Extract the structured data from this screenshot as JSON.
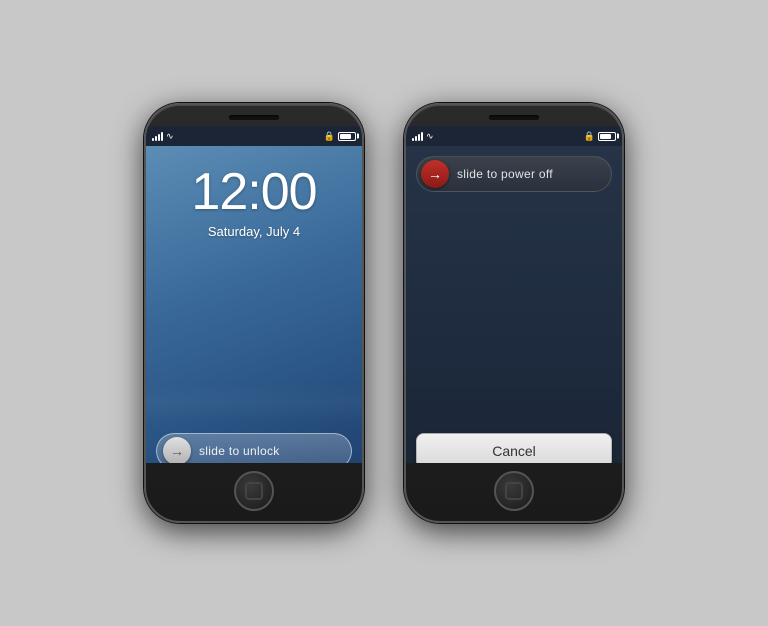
{
  "phone1": {
    "signal": "●●●●",
    "wifi": "wifi",
    "battery": "battery",
    "lock_symbol": "🔒",
    "time": "12:00",
    "date": "Saturday, July 4",
    "slide_unlock_label": "slide to unlock",
    "home_button_label": "home"
  },
  "phone2": {
    "signal": "●●●●",
    "wifi": "wifi",
    "battery": "battery",
    "lock_symbol": "🔒",
    "slide_power_label": "slide to power off",
    "cancel_label": "Cancel",
    "home_button_label": "home"
  }
}
